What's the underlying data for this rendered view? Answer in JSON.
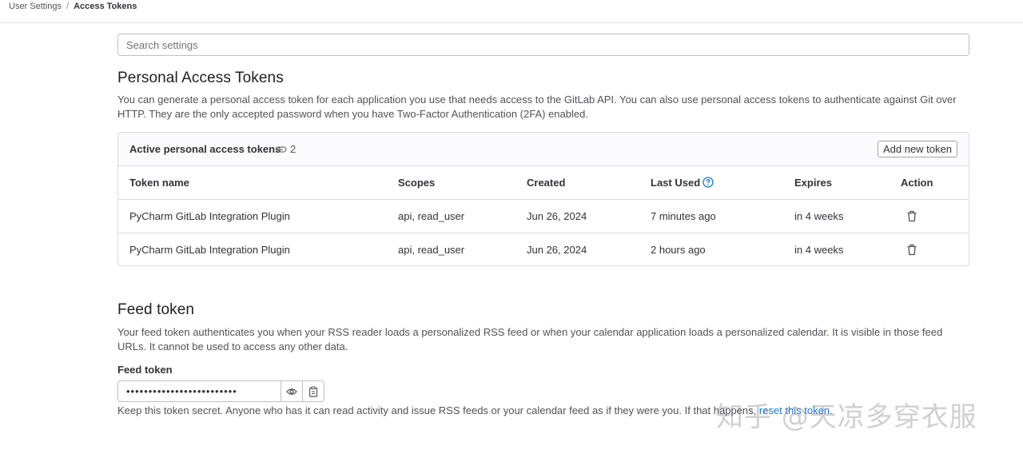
{
  "breadcrumb": {
    "parent": "User Settings",
    "separator": "/",
    "current": "Access Tokens"
  },
  "search": {
    "placeholder": "Search settings",
    "value": ""
  },
  "pat": {
    "title": "Personal Access Tokens",
    "description": "You can generate a personal access token for each application you use that needs access to the GitLab API. You can also use personal access tokens to authenticate against Git over HTTP. They are the only accepted password when you have Two-Factor Authentication (2FA) enabled.",
    "card_title": "Active personal access tokens",
    "count": "2",
    "add_button": "Add new token",
    "columns": [
      "Token name",
      "Scopes",
      "Created",
      "Last Used",
      "Expires",
      "Action"
    ],
    "rows": [
      {
        "name": "PyCharm GitLab Integration Plugin",
        "scopes": "api, read_user",
        "created": "Jun 26, 2024",
        "last_used": "7 minutes ago",
        "expires": "in 4 weeks"
      },
      {
        "name": "PyCharm GitLab Integration Plugin",
        "scopes": "api, read_user",
        "created": "Jun 26, 2024",
        "last_used": "2 hours ago",
        "expires": "in 4 weeks"
      }
    ]
  },
  "feed": {
    "title": "Feed token",
    "description": "Your feed token authenticates you when your RSS reader loads a personalized RSS feed or when your calendar application loads a personalized calendar. It is visible in those feed URLs. It cannot be used to access any other data.",
    "label": "Feed token",
    "masked_value": "•••••••••••••••••••••••••",
    "help_prefix": "Keep this token secret. Anyone who has it can read activity and issue RSS feeds or your calendar feed as if they were you. If that happens,",
    "help_link": "reset this token."
  },
  "watermark": "知乎 @天凉多穿衣服",
  "icons": {
    "token_count": "token-icon",
    "help": "question-circle-icon",
    "delete": "trash-icon",
    "reveal": "eye-icon",
    "copy": "clipboard-icon"
  },
  "colors": {
    "link": "#1f75cb",
    "help_icon": "#1f75cb",
    "border": "#dcdcde"
  }
}
